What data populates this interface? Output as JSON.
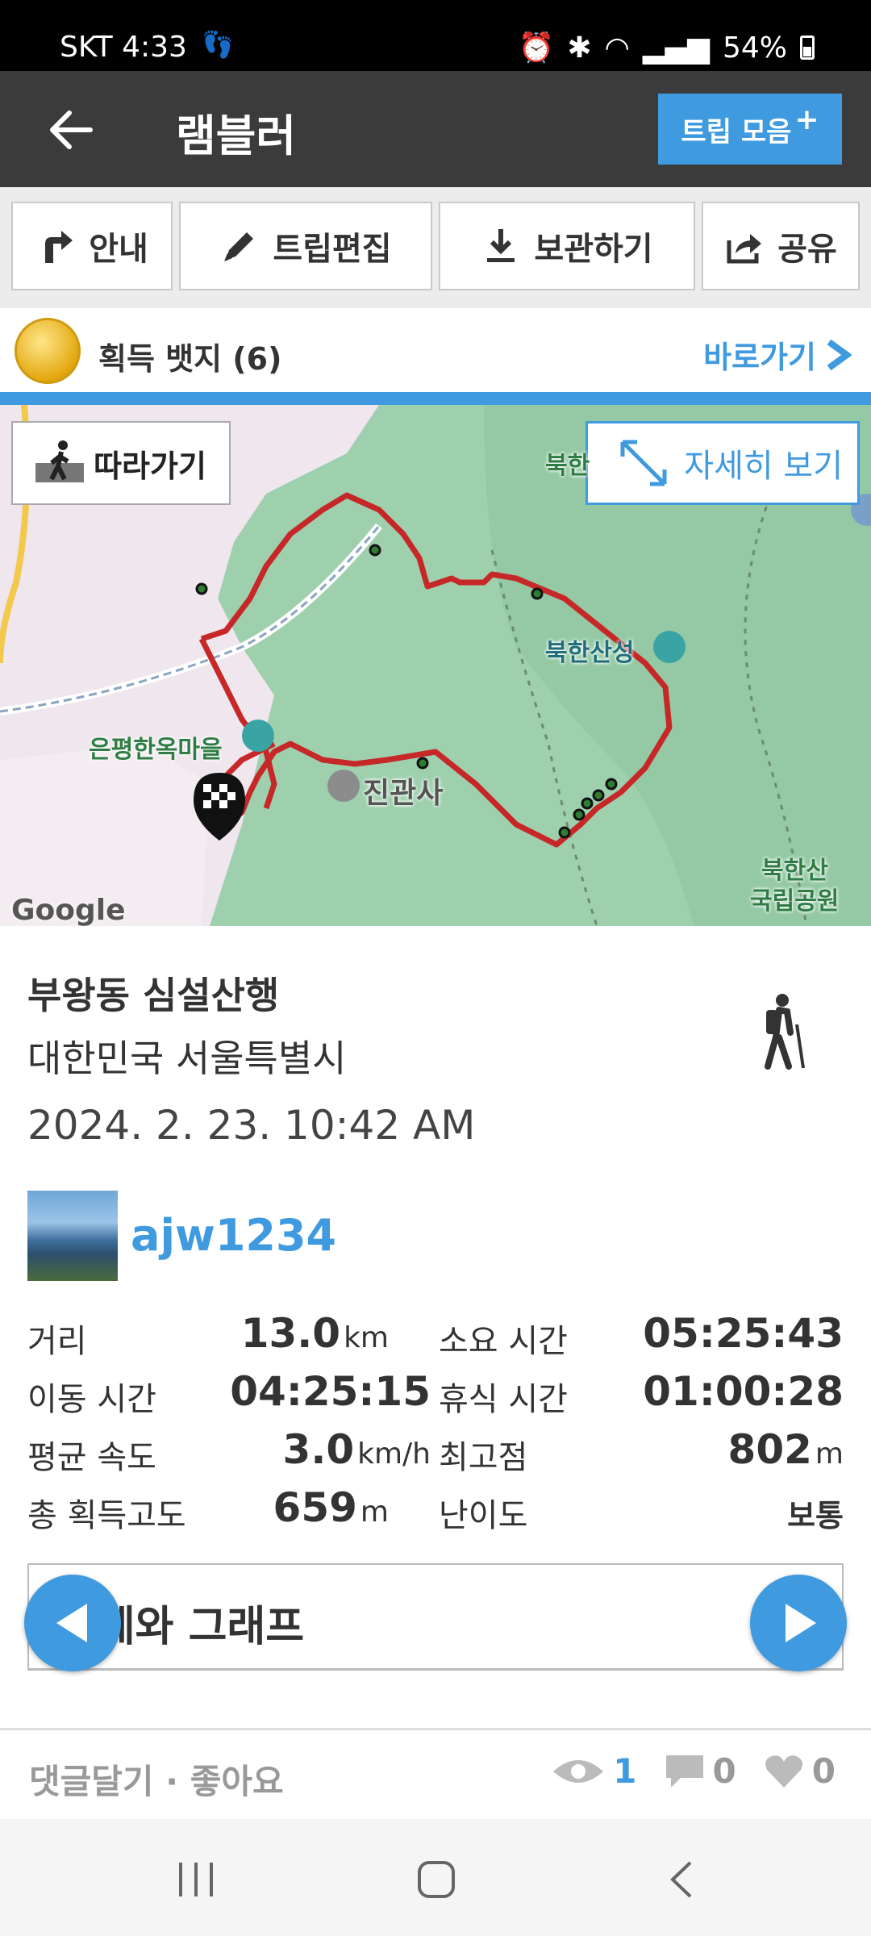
{
  "status_bar": {
    "carrier": "SKT",
    "time": "4:33",
    "battery": "54%"
  },
  "app_bar": {
    "title": "램블러",
    "trip_collection_label": "트립 모음",
    "trip_collection_plus": "+"
  },
  "actions": {
    "guide": "안내",
    "edit_trip": "트립편집",
    "save": "보관하기",
    "share": "공유"
  },
  "badges": {
    "label": "획득 뱃지 (6)",
    "shortcut": "바로가기"
  },
  "map": {
    "follow_label": "따라가기",
    "detail_label": "자세히 보기",
    "labels": {
      "village": "은평한옥마을",
      "temple": "진관사",
      "fortress": "북한산성",
      "park_line1": "북한산",
      "park_line2": "국립공원",
      "north_partial": "북한"
    },
    "attribution": "Google"
  },
  "trip": {
    "title": "부왕동 심설산행",
    "location": "대한민국 서울특별시",
    "datetime": "2024. 2. 23. 10:42 AM",
    "activity_icon": "hiker-icon"
  },
  "user": {
    "name": "ajw1234"
  },
  "stats": {
    "distance": {
      "label": "거리",
      "value": "13.0",
      "unit": "km"
    },
    "duration": {
      "label": "소요 시간",
      "value": "05:25:43"
    },
    "moving_time": {
      "label": "이동 시간",
      "value": "04:25:15"
    },
    "rest_time": {
      "label": "휴식 시간",
      "value": "01:00:28"
    },
    "avg_speed": {
      "label": "평균 속도",
      "value": "3.0",
      "unit": "km/h"
    },
    "max_elevation": {
      "label": "최고점",
      "value": "802",
      "unit": "m"
    },
    "total_ascent": {
      "label": "총 획득고도",
      "value": "659",
      "unit": "m"
    },
    "difficulty": {
      "label": "난이도",
      "value": "보통"
    }
  },
  "stats_graph": {
    "title": "통계와 그래프"
  },
  "footer": {
    "comment_like": "댓글달기 · 좋아요",
    "views": "1",
    "comments": "0",
    "likes": "0"
  },
  "colors": {
    "accent": "#3f9ae0",
    "app_bar": "#3b3b3b",
    "route": "#c62828"
  }
}
